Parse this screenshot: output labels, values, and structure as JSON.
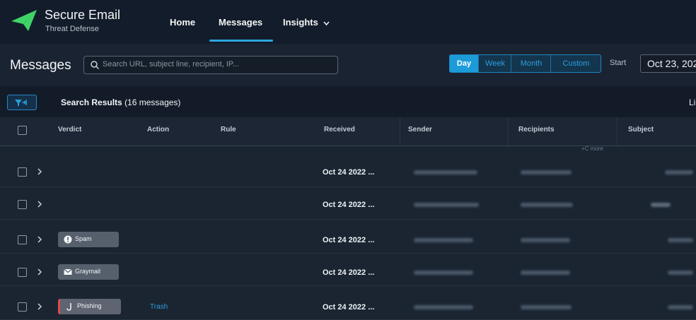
{
  "app": {
    "title": "Secure Email",
    "subtitle": "Threat Defense"
  },
  "nav": {
    "home": "Home",
    "messages": "Messages",
    "insights": "Insights"
  },
  "toolbar": {
    "page_title": "Messages",
    "search_placeholder": "Search URL, subject line, recipient, IP...",
    "ranges": [
      "Day",
      "Week",
      "Month",
      "Custom"
    ],
    "active_range": "Day",
    "start_label": "Start",
    "start_value": "Oct 23, 202"
  },
  "results": {
    "label": "Search Results",
    "count": "(16 messages)",
    "right_cut": "Li"
  },
  "table": {
    "columns": [
      "Verdict",
      "Action",
      "Rule",
      "Received",
      "Sender",
      "Recipients",
      "Subject"
    ],
    "more_note": "+C more",
    "rows": [
      {
        "verdict": "",
        "action": "",
        "received": "Oct 24 2022 ..."
      },
      {
        "verdict": "",
        "action": "",
        "received": "Oct 24 2022 ..."
      },
      {
        "verdict": "Spam",
        "action": "",
        "received": "Oct 24 2022 ..."
      },
      {
        "verdict": "Graymail",
        "action": "",
        "received": "Oct 24 2022 ..."
      },
      {
        "verdict": "Phishing",
        "action": "Trash",
        "received": "Oct 24 2022 ..."
      }
    ]
  },
  "colors": {
    "accent": "#1c9bd8",
    "background": "#1b2532",
    "nav_bg": "#131c2a",
    "phishing": "#e04a4a"
  },
  "icons": [
    "paper-plane-logo",
    "search-icon",
    "chevron-down-icon",
    "filter-icon",
    "chevron-right-icon",
    "alert-icon",
    "envelope-icon",
    "hook-icon"
  ]
}
